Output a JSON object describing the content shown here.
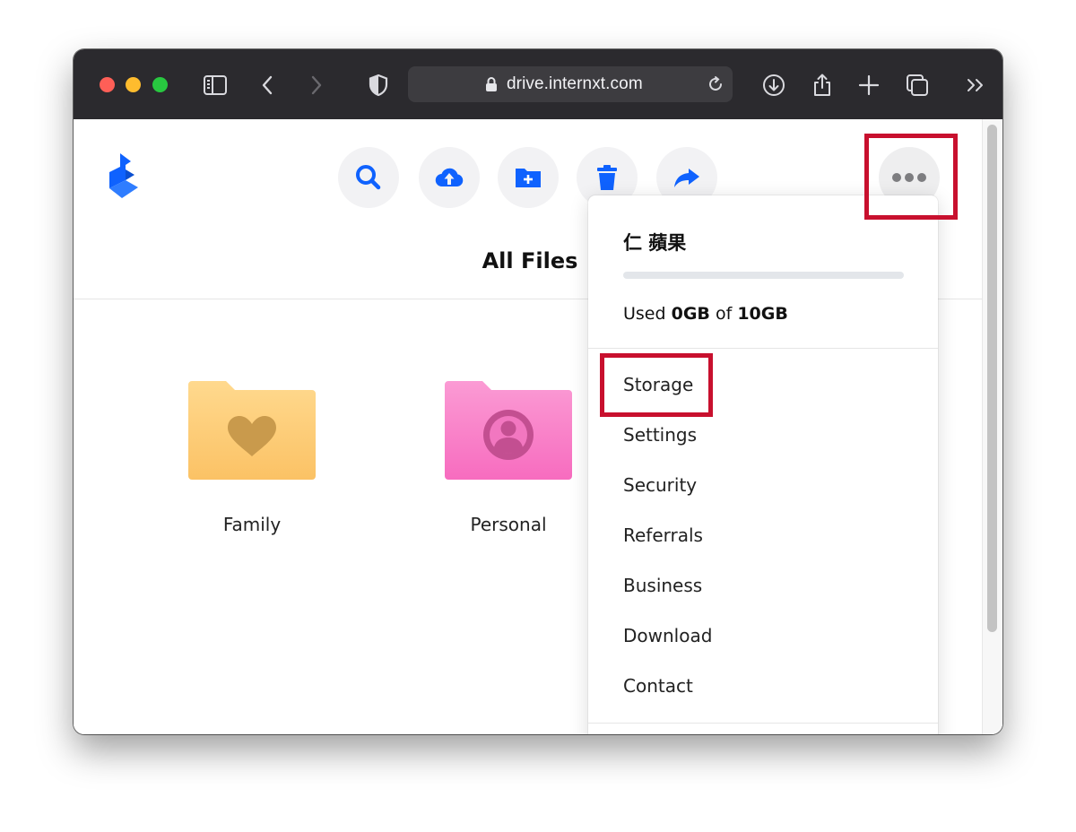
{
  "browser": {
    "url": "drive.internxt.com"
  },
  "toolbar_actions": [
    {
      "icon": "search-icon"
    },
    {
      "icon": "cloud-upload-icon"
    },
    {
      "icon": "new-folder-icon"
    },
    {
      "icon": "trash-icon"
    },
    {
      "icon": "share-icon"
    }
  ],
  "page": {
    "title": "All Files"
  },
  "folders": [
    {
      "name": "Family",
      "color": "#fcc870",
      "icon": "heart-icon"
    },
    {
      "name": "Personal",
      "color": "#fb7ec6",
      "icon": "user-icon"
    }
  ],
  "menu": {
    "user_name": "仁 蘋果",
    "usage_fraction": 0,
    "usage_prefix": "Used ",
    "usage_used": "0GB",
    "usage_middle": " of ",
    "usage_total": "10GB",
    "items": [
      "Storage",
      "Settings",
      "Security",
      "Referrals",
      "Business",
      "Download",
      "Contact"
    ]
  },
  "colors": {
    "accent": "#0f62fe",
    "highlight": "#c8102e"
  }
}
